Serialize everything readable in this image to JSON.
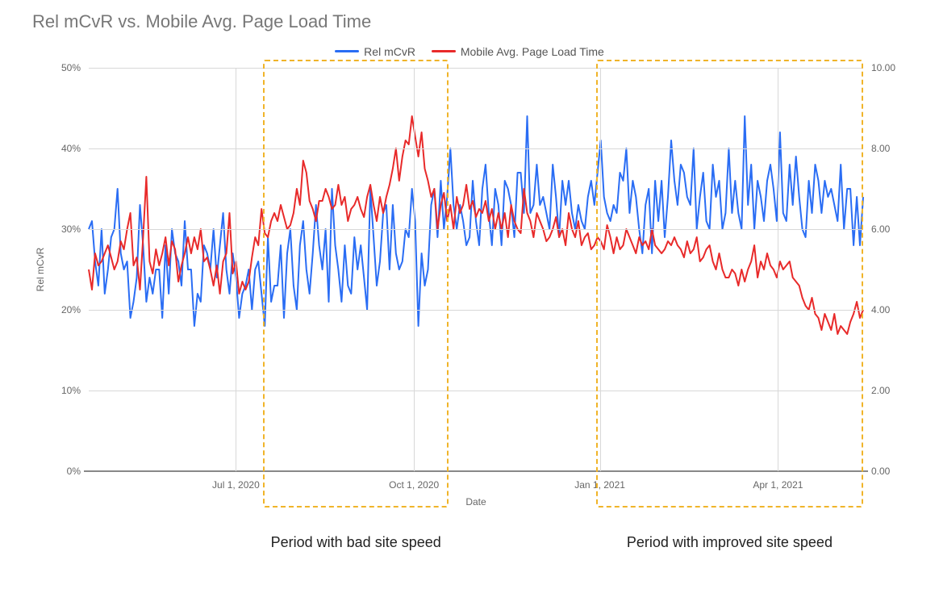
{
  "title": "Rel mCvR vs. Mobile Avg. Page Load Time",
  "legend": {
    "a": "Rel mCvR",
    "b": "Mobile Avg. Page Load Time"
  },
  "axes": {
    "ylabel": "Rel mCvR",
    "xlabel": "Date",
    "y_left_ticks": [
      "0%",
      "10%",
      "20%",
      "30%",
      "40%",
      "50%"
    ],
    "y_right_ticks": [
      "0.00",
      "2.00",
      "4.00",
      "6.00",
      "8.00",
      "10.00"
    ],
    "x_ticks": [
      "Jul 1, 2020",
      "Oct 1, 2020",
      "Jan 1, 2021",
      "Apr 1, 2021"
    ]
  },
  "colors": {
    "series_a": "#2a6df4",
    "series_b": "#e82a2a",
    "highlight": "#f0b429"
  },
  "highlights": [
    {
      "label": "Period with bad site speed"
    },
    {
      "label": "Period with improved site speed"
    }
  ],
  "chart_data": {
    "type": "line",
    "title": "Rel mCvR vs. Mobile Avg. Page Load Time",
    "xlabel": "Date",
    "ylabel": "Rel mCvR",
    "y_left_lim": [
      0,
      50
    ],
    "y_right_lim": [
      0,
      10
    ],
    "x_tick_labels": [
      "Jul 1, 2020",
      "Oct 1, 2020",
      "Jan 1, 2021",
      "Apr 1, 2021"
    ],
    "x_tick_positions": [
      0.19,
      0.42,
      0.66,
      0.89
    ],
    "highlight_periods": [
      {
        "label": "Period with bad site speed",
        "x_start": 0.225,
        "x_end": 0.465
      },
      {
        "label": "Period with improved site speed",
        "x_start": 0.655,
        "x_end": 1.0
      }
    ],
    "series": [
      {
        "name": "Rel mCvR",
        "axis": "left",
        "color": "#2a6df4",
        "values": [
          30,
          31,
          26,
          23,
          30,
          22,
          25,
          29,
          30,
          35,
          27,
          25,
          26,
          19,
          21,
          24,
          33,
          28,
          21,
          24,
          22,
          25,
          25,
          19,
          28,
          22,
          30,
          27,
          26,
          23,
          31,
          25,
          25,
          18,
          22,
          21,
          28,
          27,
          25,
          30,
          24,
          28,
          32,
          25,
          22,
          27,
          24,
          19,
          22,
          23,
          25,
          20,
          25,
          26,
          22,
          18,
          29,
          21,
          23,
          23,
          28,
          19,
          27,
          30,
          23,
          20,
          28,
          31,
          25,
          22,
          27,
          33,
          28,
          25,
          30,
          21,
          35,
          28,
          25,
          21,
          28,
          23,
          22,
          29,
          25,
          28,
          24,
          20,
          35,
          29,
          23,
          26,
          32,
          33,
          25,
          33,
          27,
          25,
          26,
          30,
          29,
          35,
          31,
          18,
          27,
          23,
          25,
          33,
          35,
          29,
          36,
          30,
          34,
          40,
          33,
          30,
          33,
          31,
          28,
          29,
          36,
          31,
          28,
          35,
          38,
          32,
          28,
          35,
          33,
          28,
          36,
          35,
          33,
          29,
          37,
          37,
          32,
          44,
          32,
          33,
          38,
          33,
          34,
          32,
          30,
          38,
          34,
          29,
          36,
          33,
          36,
          32,
          30,
          33,
          31,
          30,
          34,
          36,
          33,
          37,
          41,
          34,
          32,
          31,
          33,
          32,
          37,
          36,
          40,
          32,
          36,
          34,
          30,
          27,
          33,
          35,
          27,
          36,
          31,
          36,
          29,
          34,
          41,
          36,
          33,
          38,
          37,
          34,
          33,
          40,
          30,
          34,
          37,
          31,
          30,
          38,
          34,
          36,
          30,
          32,
          40,
          32,
          36,
          32,
          30,
          44,
          33,
          38,
          30,
          36,
          34,
          31,
          36,
          38,
          35,
          31,
          42,
          32,
          31,
          38,
          33,
          39,
          34,
          30,
          29,
          36,
          32,
          38,
          36,
          32,
          36,
          34,
          35,
          33,
          31,
          38,
          30,
          35,
          35,
          28,
          34,
          28,
          34
        ]
      },
      {
        "name": "Mobile Avg. Page Load Time",
        "axis": "right",
        "color": "#e82a2a",
        "values": [
          5.0,
          4.5,
          5.4,
          5.1,
          5.2,
          5.4,
          5.6,
          5.3,
          5.0,
          5.2,
          5.7,
          5.5,
          6.0,
          6.4,
          5.1,
          5.3,
          4.5,
          5.8,
          7.3,
          5.2,
          4.9,
          5.5,
          5.1,
          5.4,
          5.8,
          5.1,
          5.7,
          5.5,
          4.7,
          5.1,
          5.4,
          5.8,
          5.4,
          5.8,
          5.5,
          6.0,
          5.2,
          5.3,
          5.0,
          4.6,
          5.1,
          4.4,
          5.2,
          5.4,
          6.4,
          4.9,
          5.2,
          4.4,
          4.7,
          4.5,
          4.7,
          5.3,
          5.8,
          5.6,
          6.5,
          5.9,
          5.8,
          6.2,
          6.4,
          6.2,
          6.6,
          6.3,
          6.0,
          6.1,
          6.4,
          7.0,
          6.6,
          7.7,
          7.4,
          6.7,
          6.5,
          6.2,
          6.7,
          6.7,
          7.0,
          6.8,
          6.5,
          6.6,
          7.1,
          6.6,
          6.8,
          6.2,
          6.5,
          6.6,
          6.8,
          6.5,
          6.3,
          6.8,
          7.1,
          6.6,
          6.2,
          6.8,
          6.4,
          6.8,
          7.1,
          7.5,
          8.0,
          7.2,
          7.8,
          8.2,
          8.1,
          8.8,
          8.3,
          7.8,
          8.4,
          7.5,
          7.2,
          6.8,
          7.0,
          6.0,
          6.6,
          6.9,
          6.2,
          6.6,
          6.0,
          6.8,
          6.4,
          6.6,
          7.1,
          6.5,
          6.7,
          6.3,
          6.5,
          6.4,
          6.7,
          6.2,
          6.5,
          6.0,
          6.4,
          6.0,
          6.4,
          5.8,
          6.6,
          6.2,
          6.0,
          5.9,
          7.0,
          6.4,
          6.2,
          5.8,
          6.4,
          6.2,
          6.0,
          5.7,
          5.8,
          6.0,
          6.3,
          5.8,
          6.0,
          5.6,
          6.4,
          6.0,
          5.8,
          6.2,
          5.6,
          5.8,
          5.9,
          5.5,
          5.6,
          5.8,
          5.7,
          5.5,
          6.1,
          5.8,
          5.4,
          5.8,
          5.5,
          5.6,
          6.0,
          5.8,
          5.6,
          5.4,
          5.8,
          5.6,
          5.7,
          5.5,
          6.0,
          5.6,
          5.5,
          5.4,
          5.5,
          5.7,
          5.6,
          5.8,
          5.6,
          5.5,
          5.3,
          5.7,
          5.4,
          5.5,
          5.8,
          5.2,
          5.3,
          5.5,
          5.6,
          5.2,
          5.0,
          5.4,
          5.0,
          4.8,
          4.8,
          5.0,
          4.9,
          4.6,
          5.0,
          4.7,
          5.0,
          5.2,
          5.6,
          4.8,
          5.2,
          5.0,
          5.4,
          5.1,
          5.0,
          4.8,
          5.2,
          5.0,
          5.1,
          5.2,
          4.8,
          4.7,
          4.6,
          4.3,
          4.1,
          4.0,
          4.3,
          3.9,
          3.8,
          3.5,
          3.9,
          3.7,
          3.5,
          3.9,
          3.4,
          3.6,
          3.5,
          3.4,
          3.7,
          3.9,
          4.2,
          3.8,
          4.0
        ]
      }
    ]
  }
}
